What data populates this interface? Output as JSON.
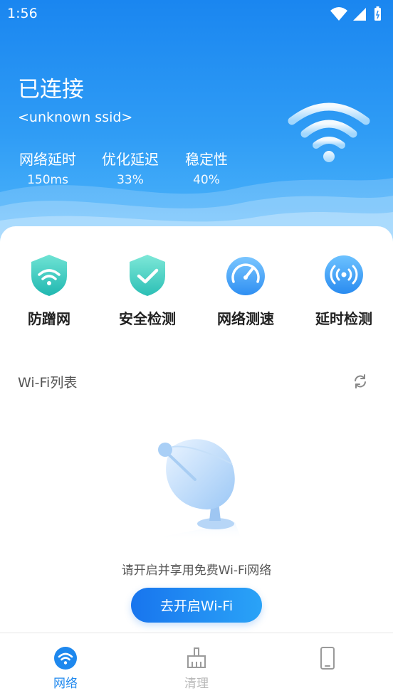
{
  "status_bar": {
    "time": "1:56"
  },
  "connection": {
    "title": "已连接",
    "ssid": "<unknown ssid>",
    "stats": [
      {
        "label": "网络延时",
        "value": "150ms"
      },
      {
        "label": "优化延迟",
        "value": "33%"
      },
      {
        "label": "稳定性",
        "value": "40%"
      }
    ]
  },
  "features": [
    {
      "label": "防蹭网",
      "icon": "shield-wifi-icon"
    },
    {
      "label": "安全检测",
      "icon": "shield-check-icon"
    },
    {
      "label": "网络测速",
      "icon": "speedometer-icon"
    },
    {
      "label": "延时检测",
      "icon": "signal-radar-icon"
    }
  ],
  "wifi_list": {
    "title": "Wi-Fi列表",
    "empty_hint": "请开启并享用免费Wi-Fi网络",
    "open_button": "去开启Wi-Fi"
  },
  "bottom_nav": [
    {
      "label": "网络",
      "active": true
    },
    {
      "label": "清理",
      "active": false
    },
    {
      "label": "",
      "active": false
    }
  ],
  "colors": {
    "header_top": "#1a86f0",
    "header_bottom": "#4fb6fb",
    "accent": "#1e88ee",
    "inactive": "#b8b8b8"
  }
}
